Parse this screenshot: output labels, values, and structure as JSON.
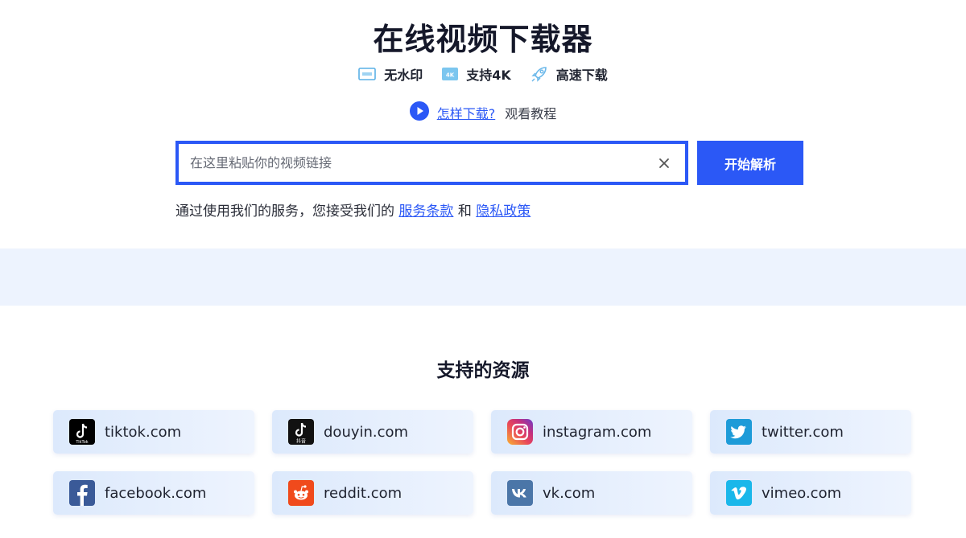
{
  "title": "在线视频下载器",
  "features": [
    {
      "icon": "no-watermark-icon",
      "label": "无水印"
    },
    {
      "icon": "4k-icon",
      "label": "支持4K"
    },
    {
      "icon": "rocket-icon",
      "label": "高速下载"
    }
  ],
  "howto": {
    "link": "怎样下载?",
    "text": "观看教程"
  },
  "search": {
    "placeholder": "在这里粘贴你的视频链接",
    "value": ""
  },
  "submit_label": "开始解析",
  "terms": {
    "prefix": "通过使用我们的服务，您接受我们的",
    "terms_link": "服务条款",
    "and": "和",
    "privacy_link": "隐私政策"
  },
  "sources_title": "支持的资源",
  "sources": [
    {
      "name": "tiktok.com",
      "icon": "tiktok-icon"
    },
    {
      "name": "douyin.com",
      "icon": "douyin-icon"
    },
    {
      "name": "instagram.com",
      "icon": "instagram-icon"
    },
    {
      "name": "twitter.com",
      "icon": "twitter-icon"
    },
    {
      "name": "facebook.com",
      "icon": "facebook-icon"
    },
    {
      "name": "reddit.com",
      "icon": "reddit-icon"
    },
    {
      "name": "vk.com",
      "icon": "vk-icon"
    },
    {
      "name": "vimeo.com",
      "icon": "vimeo-icon"
    }
  ],
  "logo_texts": {
    "tiktok": "TikTok",
    "douyin": "抖音"
  },
  "colors": {
    "accent": "#2b58f6",
    "band": "#edf3fe",
    "card_start": "#dce9fc",
    "card_end": "#eef4fe"
  }
}
